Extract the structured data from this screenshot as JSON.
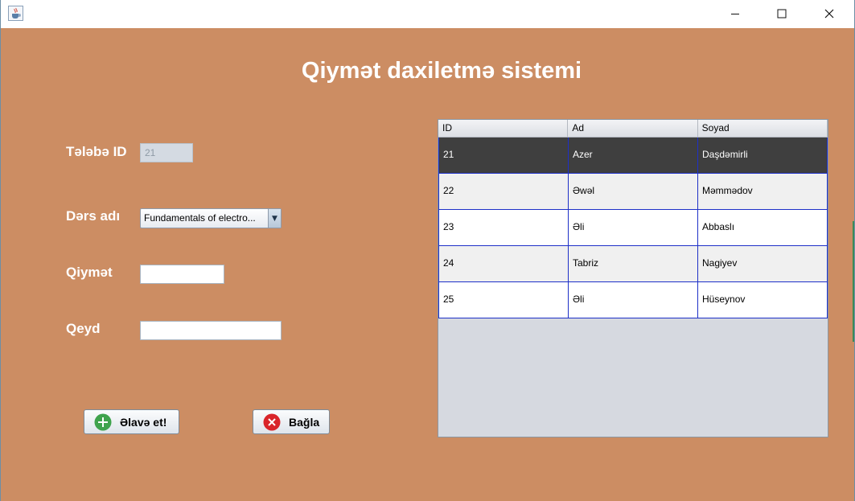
{
  "window": {
    "icon": "java-cup-icon",
    "controls": [
      "minimize-icon",
      "maximize-icon",
      "close-icon"
    ]
  },
  "header": {
    "title": "Qiymət daxiletmə sistemi"
  },
  "form": {
    "student_id": {
      "label": "Tələbə ID",
      "value": "21"
    },
    "course": {
      "label": "Dərs adı",
      "selected": "Fundamentals of electro..."
    },
    "grade": {
      "label": "Qiymət",
      "value": ""
    },
    "note": {
      "label": "Qeyd",
      "value": ""
    }
  },
  "buttons": {
    "add": {
      "label": "Əlavə et!",
      "icon": "plus-icon",
      "color": "#3fa34d"
    },
    "close": {
      "label": "Bağla",
      "icon": "close-circle-icon",
      "color": "#d9252a"
    }
  },
  "table": {
    "columns": [
      "ID",
      "Ad",
      "Soyad"
    ],
    "rows": [
      [
        "21",
        "Azer",
        "Daşdəmirli"
      ],
      [
        "22",
        "Əwəl",
        "Məmmədov"
      ],
      [
        "23",
        "Əli",
        "Abbaslı"
      ],
      [
        "24",
        "Tabriz",
        "Nagiyev"
      ],
      [
        "25",
        "Əli",
        "Hüseynov"
      ]
    ],
    "selected_row": 0
  },
  "colors": {
    "background": "#cc8d63",
    "selection": "#3f3f3f",
    "grid": "#1e30c8"
  }
}
